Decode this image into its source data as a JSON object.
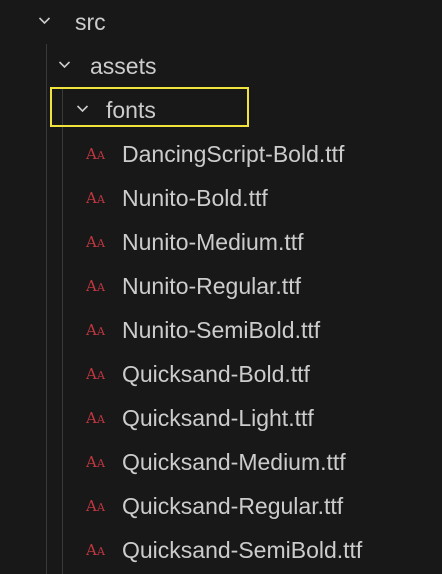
{
  "tree": {
    "src": {
      "label": "src",
      "expanded": true
    },
    "assets": {
      "label": "assets",
      "expanded": true
    },
    "fonts": {
      "label": "fonts",
      "expanded": true,
      "highlighted": true
    },
    "files": [
      {
        "name": "DancingScript-Bold.ttf",
        "icon": "font-file-icon"
      },
      {
        "name": "Nunito-Bold.ttf",
        "icon": "font-file-icon"
      },
      {
        "name": "Nunito-Medium.ttf",
        "icon": "font-file-icon"
      },
      {
        "name": "Nunito-Regular.ttf",
        "icon": "font-file-icon"
      },
      {
        "name": "Nunito-SemiBold.ttf",
        "icon": "font-file-icon"
      },
      {
        "name": "Quicksand-Bold.ttf",
        "icon": "font-file-icon"
      },
      {
        "name": "Quicksand-Light.ttf",
        "icon": "font-file-icon"
      },
      {
        "name": "Quicksand-Medium.ttf",
        "icon": "font-file-icon"
      },
      {
        "name": "Quicksand-Regular.ttf",
        "icon": "font-file-icon"
      },
      {
        "name": "Quicksand-SemiBold.ttf",
        "icon": "font-file-icon"
      }
    ]
  },
  "colors": {
    "background": "#181818",
    "text": "#cccccc",
    "font_icon": "#c2363f",
    "highlight_border": "#f2e33c",
    "indent_guide": "#3a3a3a"
  }
}
